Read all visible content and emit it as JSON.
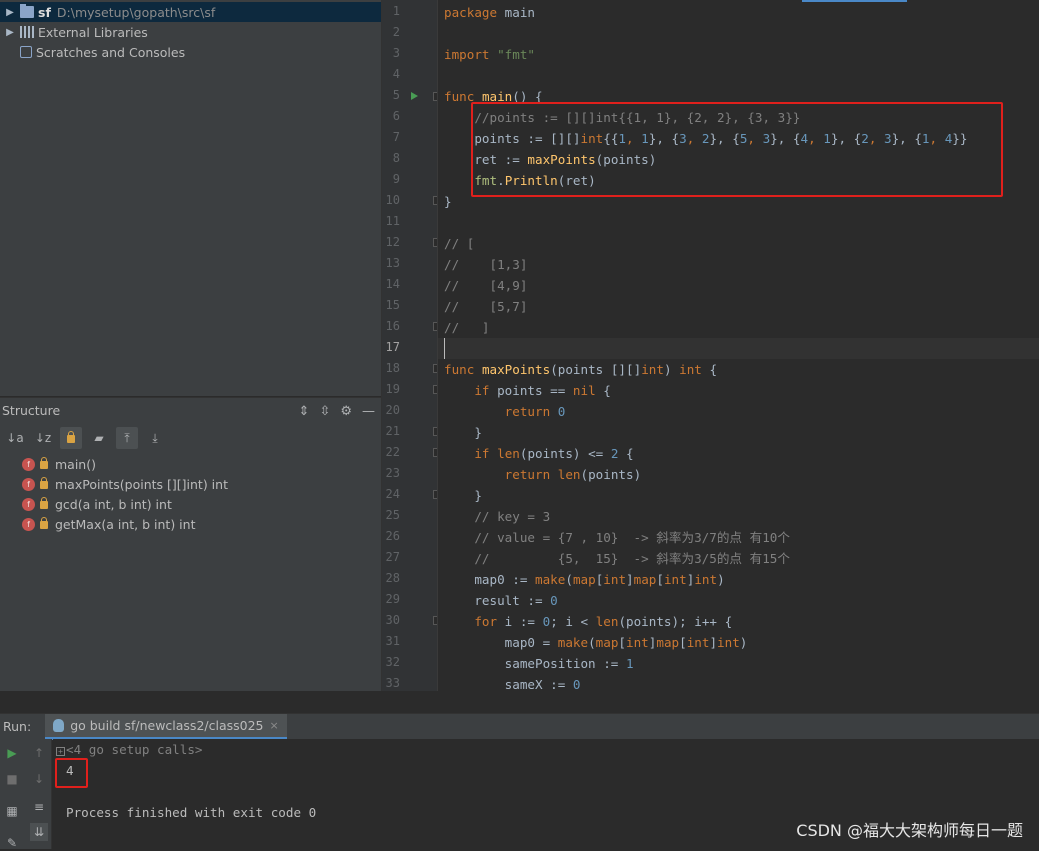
{
  "project": {
    "root_name": "sf",
    "root_path": "D:\\mysetup\\gopath\\src\\sf",
    "external_libraries": "External Libraries",
    "scratches": "Scratches and Consoles"
  },
  "structure": {
    "title": "Structure",
    "items": [
      {
        "badge": "f",
        "label": "main()"
      },
      {
        "badge": "f",
        "label": "maxPoints(points [][]int) int"
      },
      {
        "badge": "f",
        "label": "gcd(a int, b int) int"
      },
      {
        "badge": "f",
        "label": "getMax(a int, b int) int"
      }
    ]
  },
  "editor": {
    "current_line": 17,
    "line_numbers": [
      "1",
      "2",
      "3",
      "4",
      "5",
      "6",
      "7",
      "8",
      "9",
      "10",
      "11",
      "12",
      "13",
      "14",
      "15",
      "16",
      "17",
      "18",
      "19",
      "20",
      "21",
      "22",
      "23",
      "24",
      "25",
      "26",
      "27",
      "28",
      "29",
      "30",
      "31",
      "32",
      "33"
    ],
    "code": {
      "l1_a": "package",
      "l1_b": "main",
      "l3_a": "import",
      "l3_b": "\"fmt\"",
      "l5_a": "func",
      "l5_b": "main",
      "l5_c": "() {",
      "l6": "    //points := [][]int{{1, 1}, {2, 2}, {3, 3}}",
      "l7_a": "    points := [][]",
      "l7_b": "int",
      "l7_c": "{{",
      "l7_d": "1",
      "l7_e": ", ",
      "l7_f": "1",
      "l7_g": "}, {",
      "l7_h": "3",
      "l7_i": ", ",
      "l7_j": "2",
      "l7_k": "}, {",
      "l7_l": "5",
      "l7_m": ", ",
      "l7_n": "3",
      "l7_o": "}, {",
      "l7_p": "4",
      "l7_q": ", ",
      "l7_r": "1",
      "l7_s": "}, {",
      "l7_t": "2",
      "l7_u": ", ",
      "l7_v": "3",
      "l7_w": "}, {",
      "l7_x": "1",
      "l7_y": ", ",
      "l7_z": "4",
      "l7_end": "}}",
      "l8_a": "    ret := ",
      "l8_b": "maxPoints",
      "l8_c": "(points)",
      "l9_a": "    ",
      "l9_b": "fmt",
      "l9_c": ".",
      "l9_d": "Println",
      "l9_e": "(ret)",
      "l10": "}",
      "l12": "// [",
      "l13": "//    [1,3]",
      "l14": "//    [4,9]",
      "l15": "//    [5,7]",
      "l16": "//   ]",
      "l18_a": "func",
      "l18_b": "maxPoints",
      "l18_c": "(points [][]",
      "l18_d": "int",
      "l18_e": ") ",
      "l18_f": "int",
      "l18_g": " {",
      "l19_a": "    ",
      "l19_b": "if",
      "l19_c": " points == ",
      "l19_d": "nil",
      "l19_e": " {",
      "l20_a": "        ",
      "l20_b": "return",
      "l20_c": " ",
      "l20_d": "0",
      "l21": "    }",
      "l22_a": "    ",
      "l22_b": "if",
      "l22_c": " ",
      "l22_d": "len",
      "l22_e": "(points) <= ",
      "l22_f": "2",
      "l22_g": " {",
      "l23_a": "        ",
      "l23_b": "return",
      "l23_c": " ",
      "l23_d": "len",
      "l23_e": "(points)",
      "l24": "    }",
      "l25": "    // key = 3",
      "l26": "    // value = {7 , 10}  -> 斜率为3/7的点 有10个",
      "l27": "    //         {5,  15}  -> 斜率为3/5的点 有15个",
      "l28_a": "    map0 := ",
      "l28_b": "make",
      "l28_c": "(",
      "l28_d": "map",
      "l28_e": "[",
      "l28_f": "int",
      "l28_g": "]",
      "l28_h": "map",
      "l28_i": "[",
      "l28_j": "int",
      "l28_k": "]",
      "l28_l": "int",
      "l28_m": ")",
      "l29_a": "    result := ",
      "l29_b": "0",
      "l30_a": "    ",
      "l30_b": "for",
      "l30_c": " i := ",
      "l30_d": "0",
      "l30_e": "; i < ",
      "l30_f": "len",
      "l30_g": "(points); i++ {",
      "l31_a": "        map0 = ",
      "l31_b": "make",
      "l31_c": "(",
      "l31_d": "map",
      "l31_e": "[",
      "l31_f": "int",
      "l31_g": "]",
      "l31_h": "map",
      "l31_i": "[",
      "l31_j": "int",
      "l31_k": "]",
      "l31_l": "int",
      "l31_m": ")",
      "l32_a": "        samePosition := ",
      "l32_b": "1",
      "l33_a": "        sameX := ",
      "l33_b": "0"
    }
  },
  "run": {
    "label": "Run:",
    "tab_label": "go build sf/newclass2/class025",
    "close_glyph": "×",
    "setup_calls": "<4 go setup calls>",
    "output_value": "4",
    "exit_message": "Process finished with exit code 0"
  },
  "watermark": "CSDN @福大大架构师每日一题",
  "colors": {
    "keyword": "#cc7832",
    "string": "#6a8759",
    "number": "#6897bb",
    "comment": "#808080",
    "function": "#ffc66d",
    "highlight_box": "#e0201c"
  }
}
